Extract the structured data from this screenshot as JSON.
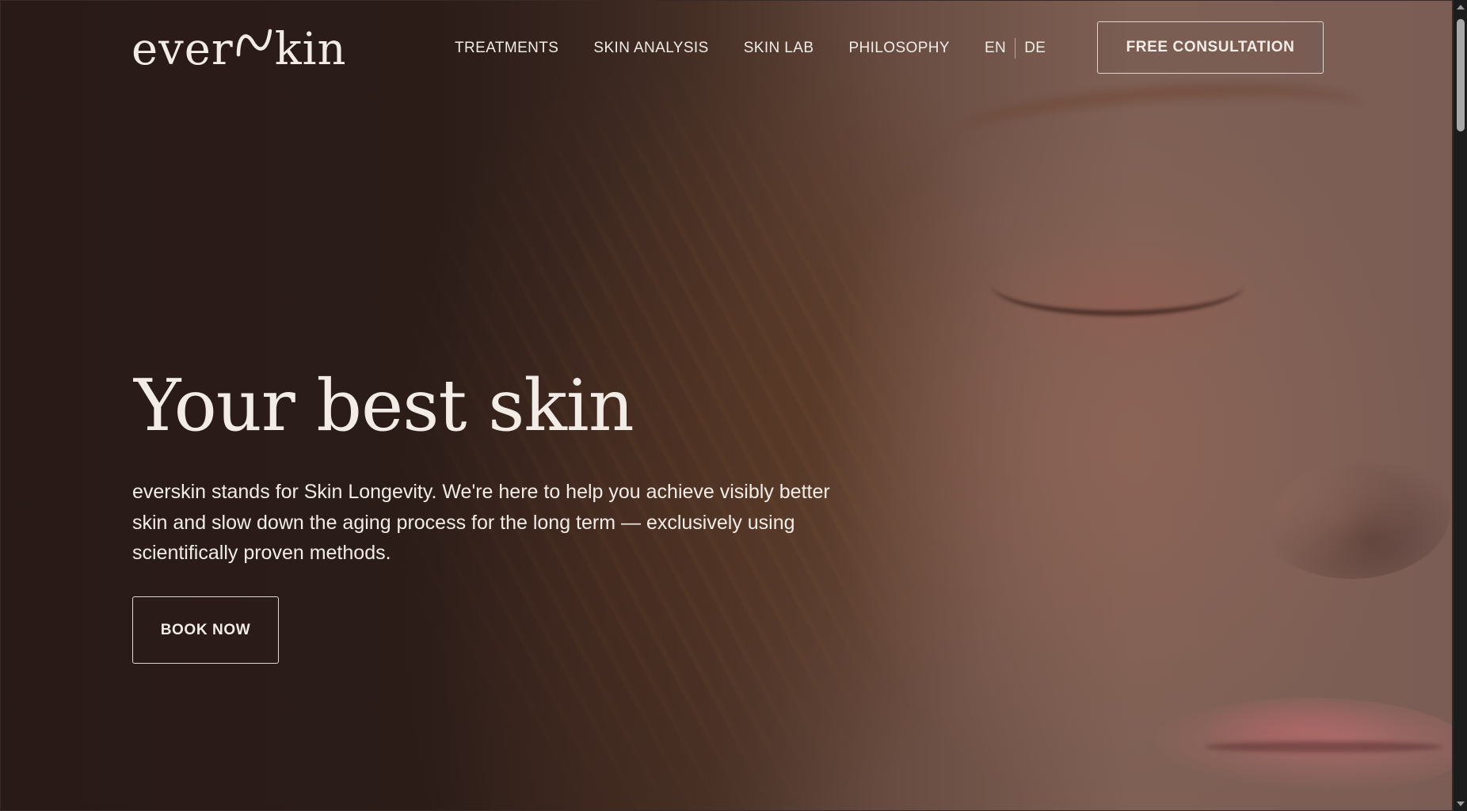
{
  "brand": {
    "logo_text_left": "ever",
    "logo_text_right": "kin",
    "logo_alt": "everskin"
  },
  "nav": {
    "items": [
      {
        "label": "TREATMENTS"
      },
      {
        "label": "SKIN ANALYSIS"
      },
      {
        "label": "SKIN LAB"
      },
      {
        "label": "PHILOSOPHY"
      }
    ],
    "languages": [
      {
        "label": "EN"
      },
      {
        "label": "DE"
      }
    ],
    "cta_label": "FREE CONSULTATION"
  },
  "hero": {
    "title": "Your best skin",
    "description": "everskin stands for Skin Longevity. We're here to help you achieve visibly better skin and slow down the aging process for the long term — exclusively using scientifically proven methods.",
    "button_label": "BOOK NOW",
    "image": "closed-eyes-freckled-face-portrait"
  },
  "theme": {
    "text_color": "#f3ece6",
    "overlay_color": "#2c1d1a"
  }
}
